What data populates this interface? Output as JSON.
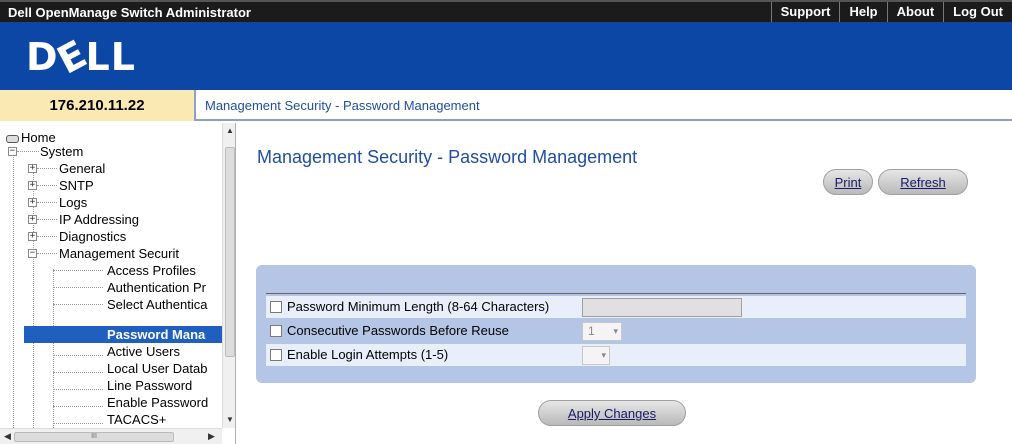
{
  "app_title": "Dell OpenManage Switch Administrator",
  "top_links": [
    "Support",
    "Help",
    "About",
    "Log Out"
  ],
  "logo_text": [
    "D",
    "E",
    "LL"
  ],
  "ip_address": "176.210.11.22",
  "breadcrumb": "Management Security - Password Management",
  "nav": {
    "home": "Home",
    "system": "System",
    "general": "General",
    "sntp": "SNTP",
    "logs": "Logs",
    "ip_addressing": "IP Addressing",
    "diagnostics": "Diagnostics",
    "management_security": "Management Securit",
    "access_profiles": "Access Profiles",
    "authentication_profiles": "Authentication Pr",
    "select_authentication": "Select Authentica",
    "password_management": "Password Mana",
    "active_users": "Active Users",
    "local_user_database": "Local User Datab",
    "line_password": "Line Password",
    "enable_password": "Enable Password",
    "tacacs": "TACACS+"
  },
  "page_title": "Management Security - Password Management",
  "buttons": {
    "print": "Print",
    "refresh": "Refresh",
    "apply": "Apply Changes"
  },
  "form": {
    "min_length_label": "Password Minimum Length (8-64 Characters)",
    "min_length_value": "",
    "reuse_label": "Consecutive Passwords Before Reuse",
    "reuse_value": "1",
    "login_attempts_label": "Enable Login Attempts (1-5)",
    "login_attempts_value": ""
  },
  "scrollbar": {
    "h_grip": "III"
  },
  "colors": {
    "banner": "#0c47a6",
    "selected_nav": "#1f5fbf",
    "ip_background": "#fbe9b4",
    "form_panel": "#b4c5e6"
  }
}
